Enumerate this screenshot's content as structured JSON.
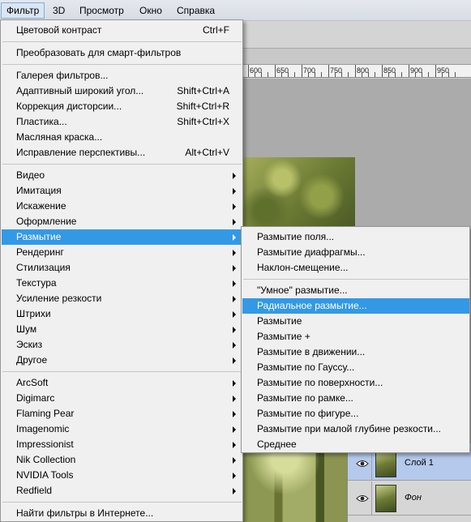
{
  "menubar": {
    "filter": "Фильтр",
    "3d": "3D",
    "view": "Просмотр",
    "window": "Окно",
    "help": "Справка"
  },
  "ruler": [
    "600",
    "650",
    "700",
    "750",
    "800",
    "850",
    "900",
    "950"
  ],
  "filter_menu": {
    "groups": [
      [
        {
          "label": "Цветовой контраст",
          "shortcut": "Ctrl+F"
        }
      ],
      [
        {
          "label": "Преобразовать для смарт-фильтров",
          "shortcut": ""
        }
      ],
      [
        {
          "label": "Галерея фильтров...",
          "shortcut": ""
        },
        {
          "label": "Адаптивный широкий угол...",
          "shortcut": "Shift+Ctrl+A"
        },
        {
          "label": "Коррекция дисторсии...",
          "shortcut": "Shift+Ctrl+R"
        },
        {
          "label": "Пластика...",
          "shortcut": "Shift+Ctrl+X"
        },
        {
          "label": "Масляная краска...",
          "shortcut": ""
        },
        {
          "label": "Исправление перспективы...",
          "shortcut": "Alt+Ctrl+V"
        }
      ],
      [
        {
          "label": "Видео",
          "submenu": true
        },
        {
          "label": "Имитация",
          "submenu": true
        },
        {
          "label": "Искажение",
          "submenu": true
        },
        {
          "label": "Оформление",
          "submenu": true
        },
        {
          "label": "Размытие",
          "submenu": true,
          "highlighted": true
        },
        {
          "label": "Рендеринг",
          "submenu": true
        },
        {
          "label": "Стилизация",
          "submenu": true
        },
        {
          "label": "Текстура",
          "submenu": true
        },
        {
          "label": "Усиление резкости",
          "submenu": true
        },
        {
          "label": "Штрихи",
          "submenu": true
        },
        {
          "label": "Шум",
          "submenu": true
        },
        {
          "label": "Эскиз",
          "submenu": true
        },
        {
          "label": "Другое",
          "submenu": true
        }
      ],
      [
        {
          "label": "ArcSoft",
          "submenu": true
        },
        {
          "label": "Digimarc",
          "submenu": true
        },
        {
          "label": "Flaming Pear",
          "submenu": true
        },
        {
          "label": "Imagenomic",
          "submenu": true
        },
        {
          "label": "Impressionist",
          "submenu": true
        },
        {
          "label": "Nik Collection",
          "submenu": true
        },
        {
          "label": "NVIDIA Tools",
          "submenu": true
        },
        {
          "label": "Redfield",
          "submenu": true
        }
      ],
      [
        {
          "label": "Найти фильтры в Интернете...",
          "shortcut": ""
        }
      ]
    ]
  },
  "blur_submenu": {
    "groups": [
      [
        {
          "label": "Размытие поля..."
        },
        {
          "label": "Размытие диафрагмы..."
        },
        {
          "label": "Наклон-смещение..."
        }
      ],
      [
        {
          "label": "\"Умное\" размытие..."
        },
        {
          "label": "Радиальное размытие...",
          "highlighted": true
        },
        {
          "label": "Размытие"
        },
        {
          "label": "Размытие +"
        },
        {
          "label": "Размытие в движении..."
        },
        {
          "label": "Размытие по Гауссу..."
        },
        {
          "label": "Размытие по поверхности..."
        },
        {
          "label": "Размытие по рамке..."
        },
        {
          "label": "Размытие по фигуре..."
        },
        {
          "label": "Размытие при малой глубине резкости..."
        },
        {
          "label": "Среднее"
        }
      ]
    ]
  },
  "layers": [
    {
      "name": "Слой 1",
      "selected": true,
      "italic": false
    },
    {
      "name": "Фон",
      "selected": false,
      "italic": true
    }
  ],
  "colors": {
    "highlight": "#3399e6",
    "layer_selected": "#b5c9ec"
  },
  "icons": {
    "visibility": "eye-icon",
    "submenu": "submenu-arrow-icon"
  }
}
